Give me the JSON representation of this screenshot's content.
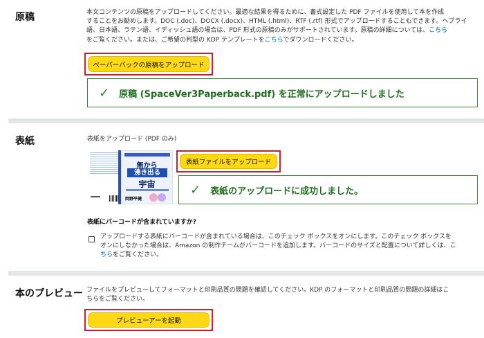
{
  "manuscript": {
    "title": "原稿",
    "description_line1": "本文コンテンツの原稿をアップロードしてください。最適な結果を得るために、書式設定した PDF ファイルを使用して本を作成",
    "description_line2": "することをお勧めします。DOC (.doc)、DOCX (.docx)、HTML (.html)、RTF (.rtf) 形式でアップロードすることもできます。ヘブライ",
    "description_line3": "語、日本語、ラテン語、イディッシュ語の場合は、PDF 形式の原稿のみがサポートされています。原稿の詳細については、",
    "description_link1": "こちら",
    "description_line4a": "をご覧ください。または、ご希望の判型の KDP テンプレートを",
    "description_link2": "こちら",
    "description_line4b": "でダウンロードください。",
    "upload_button": "ペーパーバックの原稿をアップロード",
    "success_message": "原稿 (SpaceVer3Paperback.pdf) を正常にアップロードしました"
  },
  "cover": {
    "title": "表紙",
    "subtitle": "表紙をアップロード (PDF のみ)",
    "upload_button": "表紙ファイルをアップロード",
    "success_message": "表紙のアップロードに成功しました。",
    "thumbnail": {
      "line1": "無から",
      "line2": "沸き出る",
      "line3": "宇宙",
      "author": "岡野平健"
    },
    "barcode_question": "表紙にバーコードが含まれていますか?",
    "barcode_text_line1": "アップロードする表紙にバーコードが含まれている場合は、このチェック ボックスをオンにします。このチェック ボックスを",
    "barcode_text_line2": "オンにしなかった場合は、Amazon の制作チームがバーコードを追加します。バーコードのサイズと配置について詳しくは、こ",
    "barcode_link": "ちら",
    "barcode_text_line3": "をご覧ください。"
  },
  "preview": {
    "title": "本のプレビュー",
    "description_line1": "ファイルをプレビューしてフォーマットと印刷品質の問題を確認してください。KDP のフォーマットと印刷品質の問題の詳細はこ",
    "description_line2": "ちらをご覧ください。",
    "button": "プレビューアーを起動"
  }
}
